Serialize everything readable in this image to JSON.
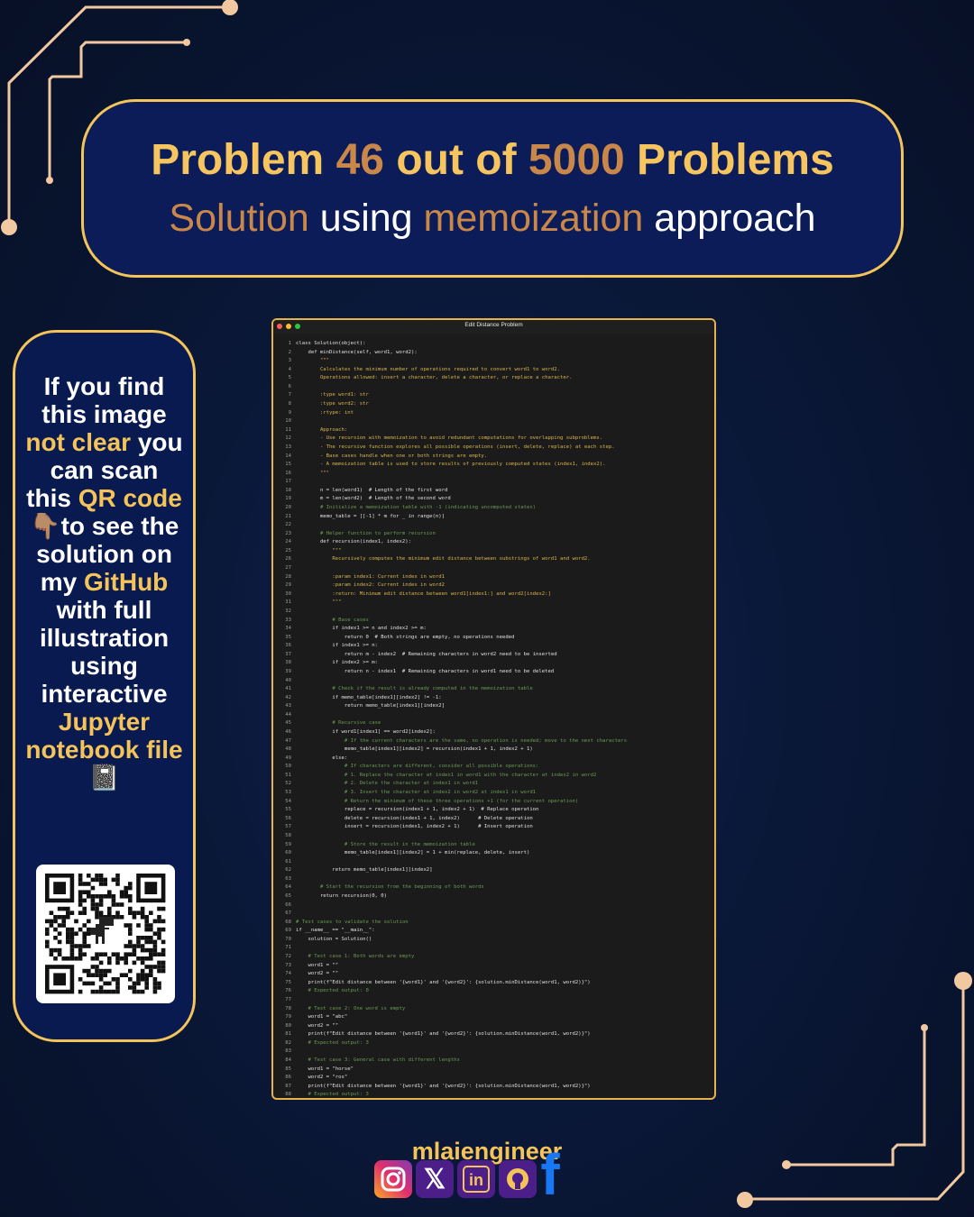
{
  "header": {
    "title_prefix": "Problem",
    "problem_number": "46",
    "title_mid": "out of",
    "problem_total": "5000",
    "title_suffix": "Problems",
    "sub_word1": "Solution",
    "sub_word2": "using",
    "sub_word3": "memoization",
    "sub_word4": "approach"
  },
  "side": {
    "t1": "If you find this image ",
    "t2": "not clear",
    "t3": " you can scan this ",
    "t4": "QR code",
    "t5": " 👇🏽to see the solution on my ",
    "t6": "GitHub",
    "t7": " with full illustration using interactive ",
    "t8": "Jupyter notebook file",
    "t9": "📓"
  },
  "window": {
    "title": "Edit Distance Problem"
  },
  "code_lines": [
    {
      "text": "class Solution(object):",
      "type": "code"
    },
    {
      "text": "    def minDistance(self, word1, word2):",
      "type": "code"
    },
    {
      "text": "        \"\"\"",
      "type": "doc"
    },
    {
      "text": "        Calculates the minimum number of operations required to convert word1 to word2.",
      "type": "doc"
    },
    {
      "text": "        Operations allowed: insert a character, delete a character, or replace a character.",
      "type": "doc"
    },
    {
      "text": "",
      "type": "doc"
    },
    {
      "text": "        :type word1: str",
      "type": "doc"
    },
    {
      "text": "        :type word2: str",
      "type": "doc"
    },
    {
      "text": "        :rtype: int",
      "type": "doc"
    },
    {
      "text": "",
      "type": "doc"
    },
    {
      "text": "        Approach:",
      "type": "doc"
    },
    {
      "text": "        - Use recursion with memoization to avoid redundant computations for overlapping subproblems.",
      "type": "doc"
    },
    {
      "text": "        - The recursive function explores all possible operations (insert, delete, replace) at each step.",
      "type": "doc"
    },
    {
      "text": "        - Base cases handle when one or both strings are empty.",
      "type": "doc"
    },
    {
      "text": "        - A memoization table is used to store results of previously computed states (index1, index2).",
      "type": "doc"
    },
    {
      "text": "        \"\"\"",
      "type": "doc"
    },
    {
      "text": "",
      "type": "code"
    },
    {
      "text": "        n = len(word1)  # Length of the first word",
      "type": "code"
    },
    {
      "text": "        m = len(word2)  # Length of the second word",
      "type": "code"
    },
    {
      "text": "        # Initialize a memoization table with -1 (indicating uncomputed states)",
      "type": "com"
    },
    {
      "text": "        memo_table = [[-1] * m for _ in range(n)]",
      "type": "code"
    },
    {
      "text": "",
      "type": "code"
    },
    {
      "text": "        # Helper function to perform recursion",
      "type": "com"
    },
    {
      "text": "        def recursion(index1, index2):",
      "type": "code"
    },
    {
      "text": "            \"\"\"",
      "type": "doc"
    },
    {
      "text": "            Recursively computes the minimum edit distance between substrings of word1 and word2.",
      "type": "doc"
    },
    {
      "text": "",
      "type": "doc"
    },
    {
      "text": "            :param index1: Current index in word1",
      "type": "doc"
    },
    {
      "text": "            :param index2: Current index in word2",
      "type": "doc"
    },
    {
      "text": "            :return: Minimum edit distance between word1[index1:] and word2[index2:]",
      "type": "doc"
    },
    {
      "text": "            \"\"\"",
      "type": "doc"
    },
    {
      "text": "",
      "type": "code"
    },
    {
      "text": "            # Base cases",
      "type": "com"
    },
    {
      "text": "            if index1 >= n and index2 >= m:",
      "type": "code"
    },
    {
      "text": "                return 0  # Both strings are empty, no operations needed",
      "type": "code"
    },
    {
      "text": "            if index1 >= n:",
      "type": "code"
    },
    {
      "text": "                return m - index2  # Remaining characters in word2 need to be inserted",
      "type": "code"
    },
    {
      "text": "            if index2 >= m:",
      "type": "code"
    },
    {
      "text": "                return n - index1  # Remaining characters in word1 need to be deleted",
      "type": "code"
    },
    {
      "text": "",
      "type": "code"
    },
    {
      "text": "            # Check if the result is already computed in the memoization table",
      "type": "com"
    },
    {
      "text": "            if memo_table[index1][index2] != -1:",
      "type": "code"
    },
    {
      "text": "                return memo_table[index1][index2]",
      "type": "code"
    },
    {
      "text": "",
      "type": "code"
    },
    {
      "text": "            # Recursive case",
      "type": "com"
    },
    {
      "text": "            if word1[index1] == word2[index2]:",
      "type": "code"
    },
    {
      "text": "                # If the current characters are the same, no operation is needed; move to the next characters",
      "type": "com"
    },
    {
      "text": "                memo_table[index1][index2] = recursion(index1 + 1, index2 + 1)",
      "type": "code"
    },
    {
      "text": "            else:",
      "type": "code"
    },
    {
      "text": "                # If characters are different, consider all possible operations:",
      "type": "com"
    },
    {
      "text": "                # 1. Replace the character at index1 in word1 with the character at index2 in word2",
      "type": "com"
    },
    {
      "text": "                # 2. Delete the character at index1 in word1",
      "type": "com"
    },
    {
      "text": "                # 3. Insert the character at index2 in word2 at index1 in word1",
      "type": "com"
    },
    {
      "text": "                # Return the minimum of these three operations +1 (for the current operation)",
      "type": "com"
    },
    {
      "text": "                replace = recursion(index1 + 1, index2 + 1)  # Replace operation",
      "type": "code"
    },
    {
      "text": "                delete = recursion(index1 + 1, index2)      # Delete operation",
      "type": "code"
    },
    {
      "text": "                insert = recursion(index1, index2 + 1)      # Insert operation",
      "type": "code"
    },
    {
      "text": "",
      "type": "code"
    },
    {
      "text": "                # Store the result in the memoization table",
      "type": "com"
    },
    {
      "text": "                memo_table[index1][index2] = 1 + min(replace, delete, insert)",
      "type": "code"
    },
    {
      "text": "",
      "type": "code"
    },
    {
      "text": "            return memo_table[index1][index2]",
      "type": "code"
    },
    {
      "text": "",
      "type": "code"
    },
    {
      "text": "        # Start the recursion from the beginning of both words",
      "type": "com"
    },
    {
      "text": "        return recursion(0, 0)",
      "type": "code"
    },
    {
      "text": "",
      "type": "code"
    },
    {
      "text": "",
      "type": "code"
    },
    {
      "text": "# Test cases to validate the solution",
      "type": "com"
    },
    {
      "text": "if __name__ == \"__main__\":",
      "type": "code"
    },
    {
      "text": "    solution = Solution()",
      "type": "code"
    },
    {
      "text": "",
      "type": "code"
    },
    {
      "text": "    # Test case 1: Both words are empty",
      "type": "com"
    },
    {
      "text": "    word1 = \"\"",
      "type": "code"
    },
    {
      "text": "    word2 = \"\"",
      "type": "code"
    },
    {
      "text": "    print(f\"Edit distance between '{word1}' and '{word2}': {solution.minDistance(word1, word2)}\")",
      "type": "code"
    },
    {
      "text": "    # Expected output: 0",
      "type": "com"
    },
    {
      "text": "",
      "type": "code"
    },
    {
      "text": "    # Test case 2: One word is empty",
      "type": "com"
    },
    {
      "text": "    word1 = \"abc\"",
      "type": "code"
    },
    {
      "text": "    word2 = \"\"",
      "type": "code"
    },
    {
      "text": "    print(f\"Edit distance between '{word1}' and '{word2}': {solution.minDistance(word1, word2)}\")",
      "type": "code"
    },
    {
      "text": "    # Expected output: 3",
      "type": "com"
    },
    {
      "text": "",
      "type": "code"
    },
    {
      "text": "    # Test case 3: General case with different lengths",
      "type": "com"
    },
    {
      "text": "    word1 = \"horse\"",
      "type": "code"
    },
    {
      "text": "    word2 = \"ros\"",
      "type": "code"
    },
    {
      "text": "    print(f\"Edit distance between '{word1}' and '{word2}': {solution.minDistance(word1, word2)}\")",
      "type": "code"
    },
    {
      "text": "    # Expected output: 3",
      "type": "com"
    }
  ],
  "footer": {
    "brand": "mlaiengineer",
    "socials": [
      {
        "icon": "instagram-icon",
        "color": "#e1306c"
      },
      {
        "icon": "x-icon",
        "color": "#4b1e8a"
      },
      {
        "icon": "linkedin-icon",
        "color": "#4b1e8a"
      },
      {
        "icon": "github-icon",
        "color": "#4b1e8a"
      },
      {
        "icon": "facebook-icon",
        "color": "#1877f2"
      }
    ]
  },
  "colors": {
    "accent_gold": "#f4c35a",
    "accent_copper": "#c9874a",
    "background": "#0a1838"
  }
}
